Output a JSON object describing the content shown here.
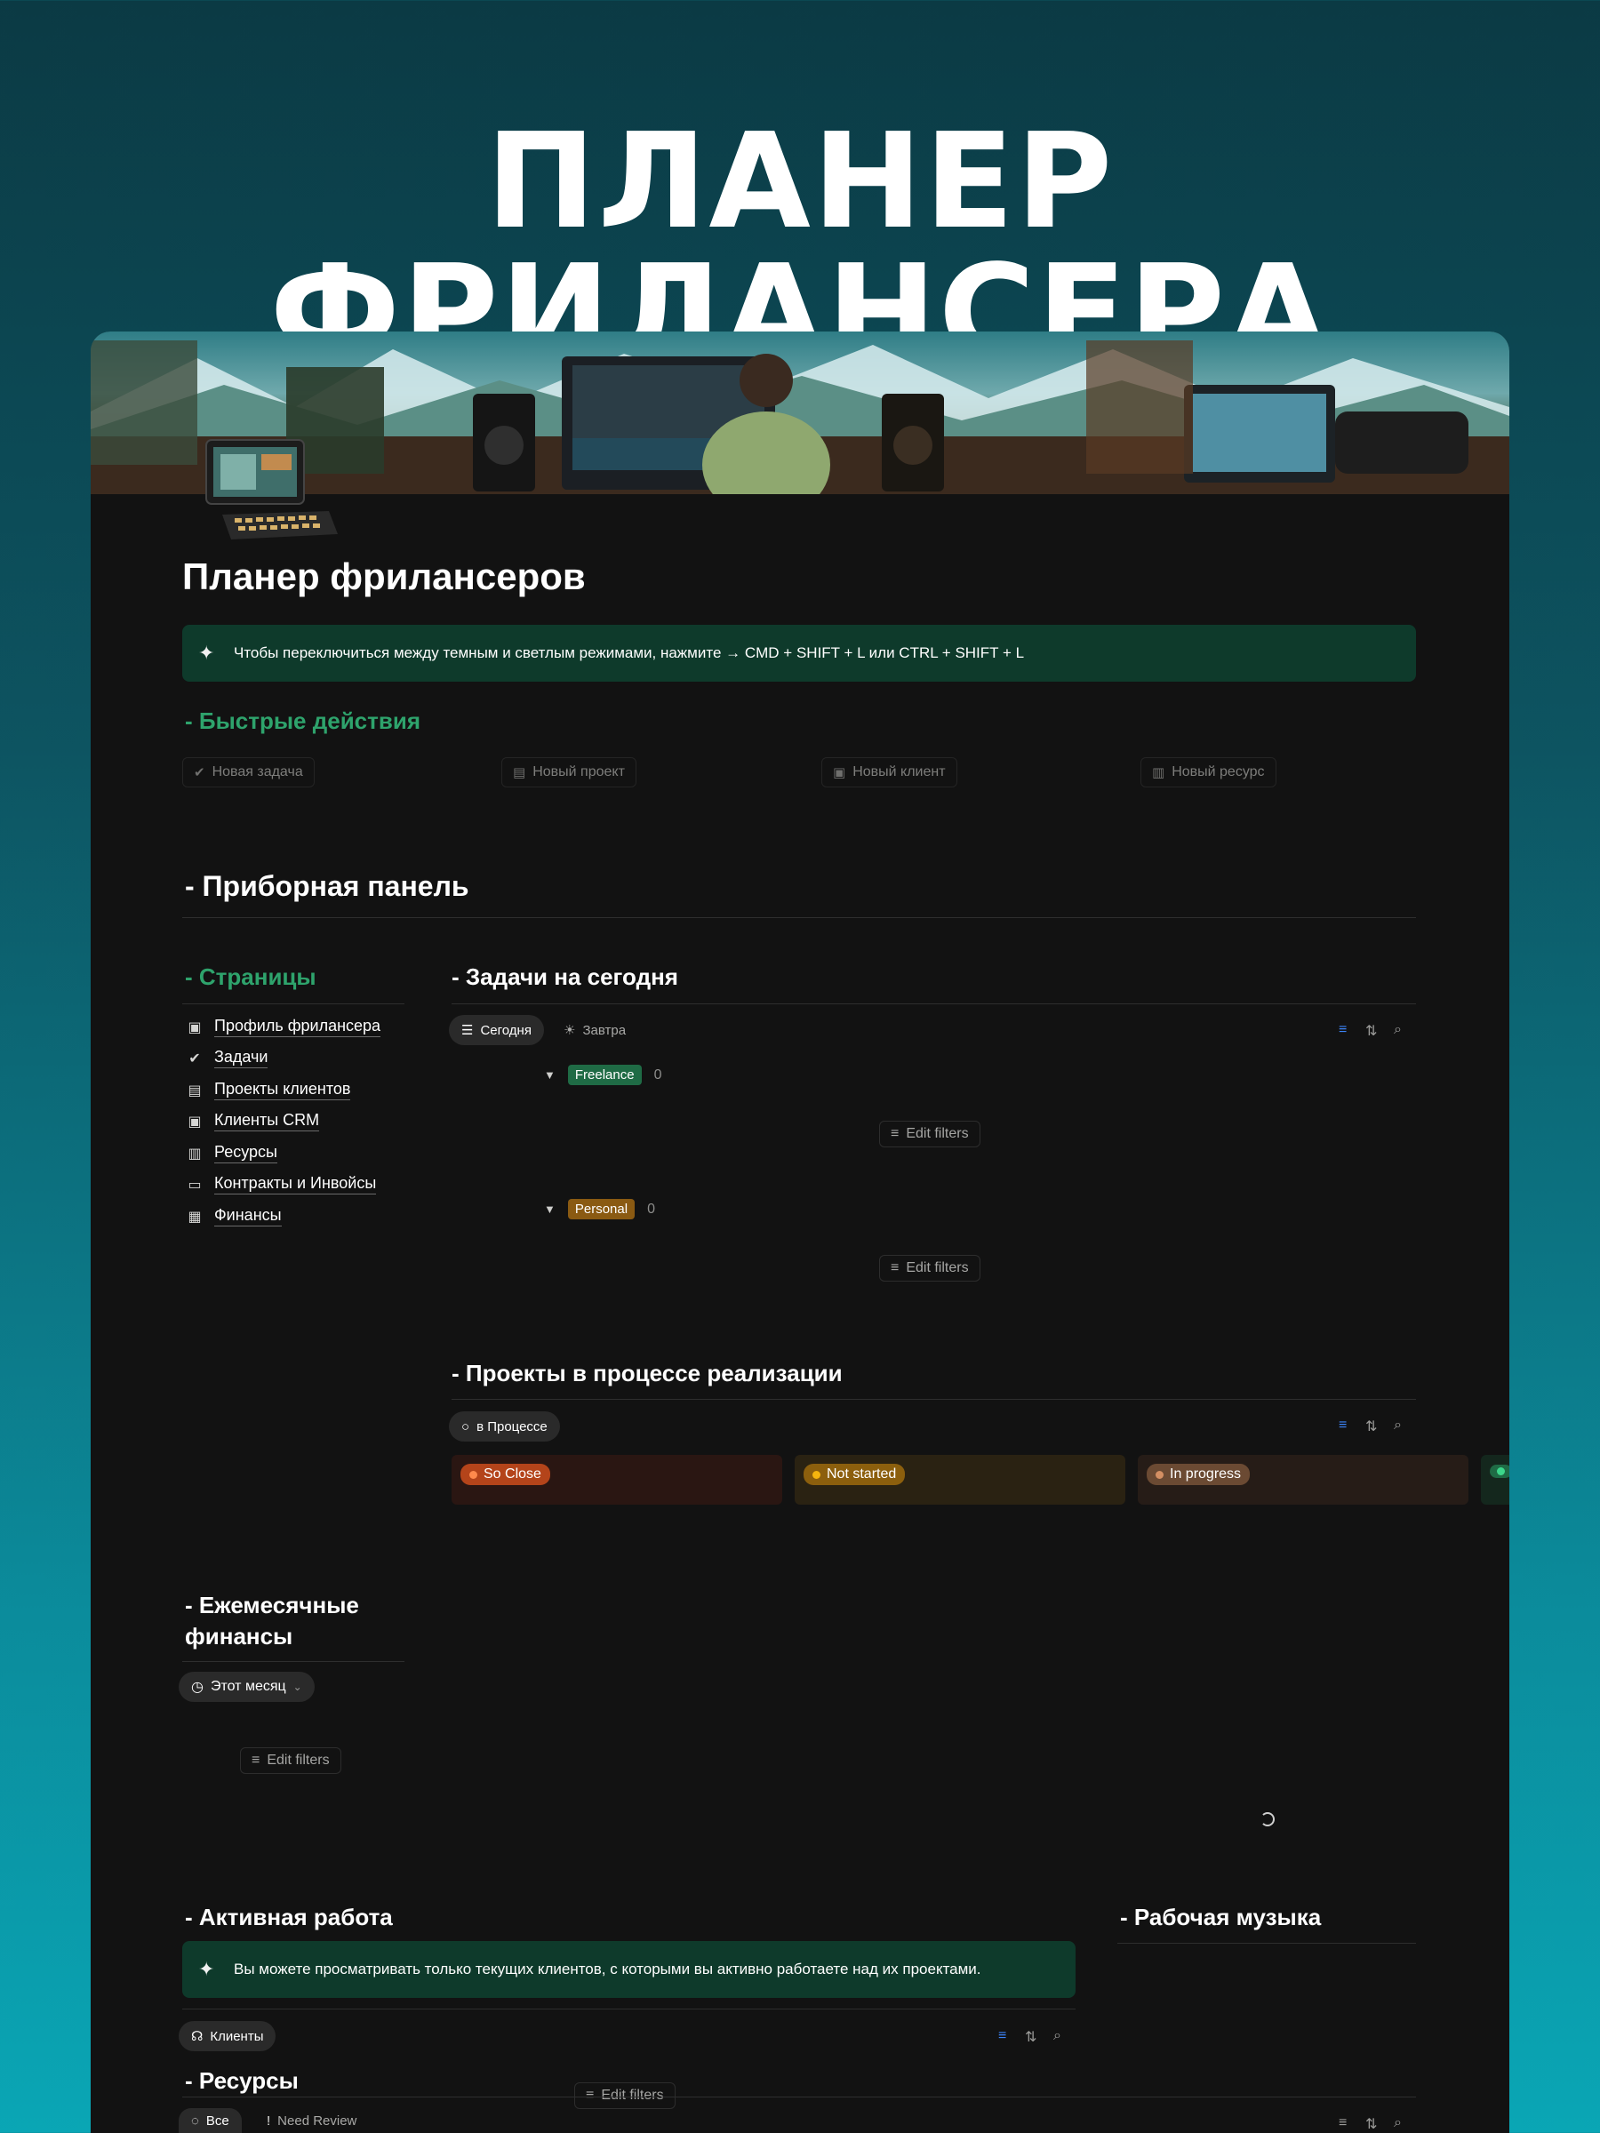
{
  "hero": {
    "title": "ПЛАНЕР ФРИЛАНСЕРА"
  },
  "page": {
    "title": "Планер фрилансеров",
    "tip": "Чтобы переключиться между темным и светлым режимами, нажмите → CMD + SHIFT + L или CTRL + SHIFT + L"
  },
  "quick_actions": {
    "heading": "- Быстрые действия",
    "buttons": [
      {
        "label": "Новая задача",
        "icon": "check-badge-icon"
      },
      {
        "label": "Новый проект",
        "icon": "folder-icon"
      },
      {
        "label": "Новый клиент",
        "icon": "contact-card-icon"
      },
      {
        "label": "Новый ресурс",
        "icon": "archive-box-icon"
      }
    ]
  },
  "dashboard": {
    "heading": "- Приборная панель"
  },
  "pages_nav": {
    "heading": "- Страницы",
    "items": [
      {
        "label": "Профиль фрилансера",
        "icon": "contact-card-icon"
      },
      {
        "label": "Задачи",
        "icon": "check-badge-icon"
      },
      {
        "label": "Проекты клиентов",
        "icon": "folder-icon"
      },
      {
        "label": "Клиенты CRM",
        "icon": "contact-card-icon"
      },
      {
        "label": "Ресурсы",
        "icon": "archive-box-icon"
      },
      {
        "label": "Контракты и Инвойсы",
        "icon": "id-card-icon"
      },
      {
        "label": "Финансы",
        "icon": "money-icon"
      }
    ]
  },
  "monthly_finance": {
    "heading_line1": "- Ежемесячные",
    "heading_line2": "финансы",
    "view_chip": "Этот месяц",
    "edit_filters": "Edit filters"
  },
  "tasks_today": {
    "heading": "- Задачи на сегодня",
    "tabs": [
      {
        "label": "Сегодня",
        "active": true
      },
      {
        "label": "Завтра",
        "active": false
      }
    ],
    "groups": [
      {
        "tag": "Freelance",
        "tag_color": "#1f6b45",
        "count": "0",
        "edit_filters": "Edit filters"
      },
      {
        "tag": "Personal",
        "tag_color": "#8a5a12",
        "count": "0",
        "edit_filters": "Edit filters"
      }
    ]
  },
  "projects_in_progress": {
    "heading": "- Проекты в процессе реализации",
    "view_chip": "в Процессе",
    "columns": [
      {
        "label": "So Close",
        "pill_color": "#b4441a",
        "dot_color": "#ff8a4c",
        "bg": "#2a1612"
      },
      {
        "label": "Not started",
        "pill_color": "#8c5f0d",
        "dot_color": "#f5b50e",
        "bg": "#2a2212"
      },
      {
        "label": "In progress",
        "pill_color": "#6b4a33",
        "dot_color": "#d48f63",
        "bg": "#261c17"
      },
      {
        "label": "",
        "pill_color": "#1f6b45",
        "dot_color": "#3cd68a",
        "bg": "#14271d"
      }
    ]
  },
  "active_work": {
    "heading": "- Активная работа",
    "tip": "Вы можете просматривать только текущих клиентов, с которыми вы активно работаете над их проектами.",
    "view_chip": "Клиенты",
    "edit_filters": "Edit filters"
  },
  "work_music": {
    "heading": "- Рабочая музыка"
  },
  "resources": {
    "heading": "- Ресурсы",
    "tabs": [
      {
        "label": "Все",
        "active": true
      },
      {
        "label": "Need Review",
        "active": false
      }
    ]
  },
  "colors": {
    "accent_green": "#2ea36c",
    "callout_bg": "#0e3a2b",
    "page_bg": "#121212",
    "filter_active_blue": "#3b82f6"
  }
}
